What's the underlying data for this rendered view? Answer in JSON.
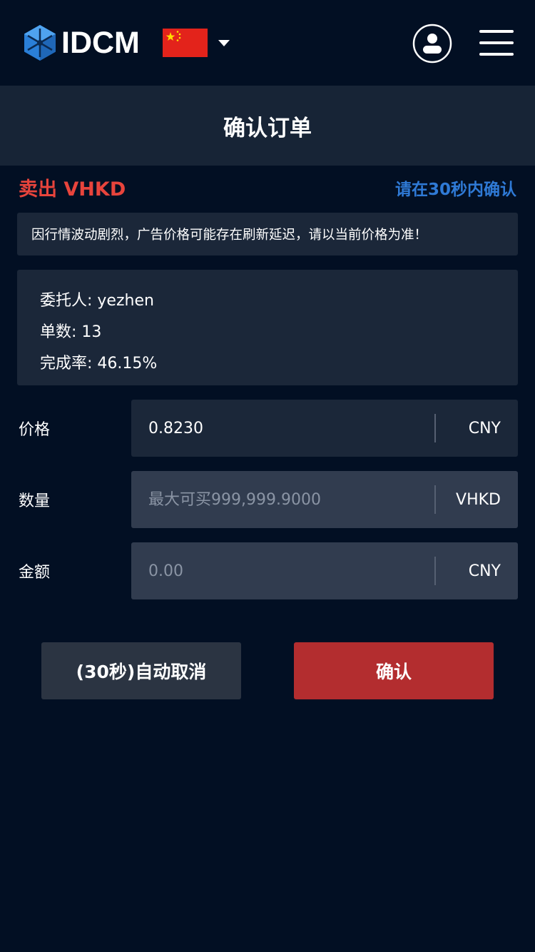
{
  "header": {
    "logo_text": "IDCM",
    "language_flag": "cn-flag-icon",
    "user_icon": "user-icon",
    "menu_icon": "hamburger-menu-icon"
  },
  "page": {
    "title": "确认订单"
  },
  "order": {
    "side_label": "卖出 VHKD",
    "countdown_text": "请在30秒内确认",
    "notice": "因行情波动剧烈，广告价格可能存在刷新延迟，请以当前价格为准！"
  },
  "advertiser": {
    "name_line": "委托人: yezhen",
    "orders_line": "单数: 13",
    "completion_line": "完成率: 46.15%"
  },
  "form": {
    "price": {
      "label": "价格",
      "value": "0.8230",
      "unit": "CNY"
    },
    "quantity": {
      "label": "数量",
      "placeholder": "最大可买999,999.9000",
      "unit": "VHKD"
    },
    "amount": {
      "label": "金额",
      "placeholder": "0.00",
      "unit": "CNY"
    }
  },
  "actions": {
    "cancel_label": "(30秒)自动取消",
    "confirm_label": "确认"
  },
  "colors": {
    "background": "#020f23",
    "panel": "#1b2739",
    "title_bar": "#172436",
    "sell_red": "#e8443c",
    "accent_blue": "#2f7ad6",
    "confirm_button": "#b32d2f",
    "cancel_button": "#2b3442"
  }
}
